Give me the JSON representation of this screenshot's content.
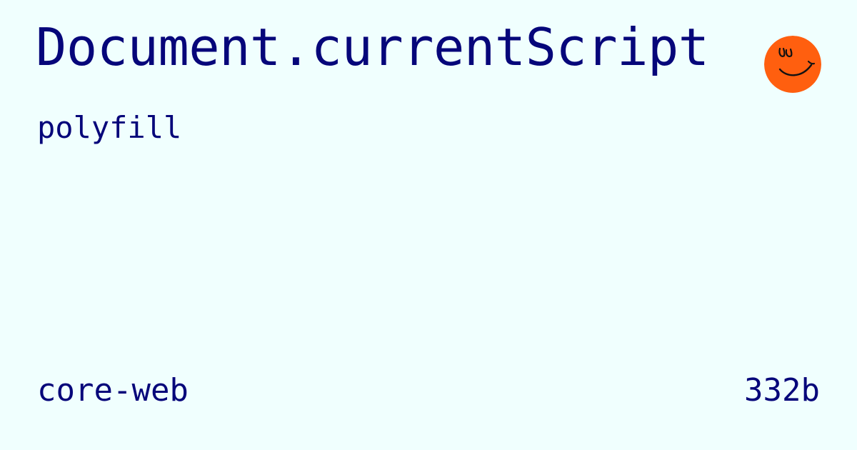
{
  "card": {
    "title": "Document.currentScript",
    "subtitle": "polyfill",
    "package": "core-web",
    "size": "332b"
  },
  "logo": {
    "icon": "smiley-face-icon",
    "color": "#ff5f0f"
  },
  "colors": {
    "background": "#f0fffe",
    "text": "#06067a"
  }
}
